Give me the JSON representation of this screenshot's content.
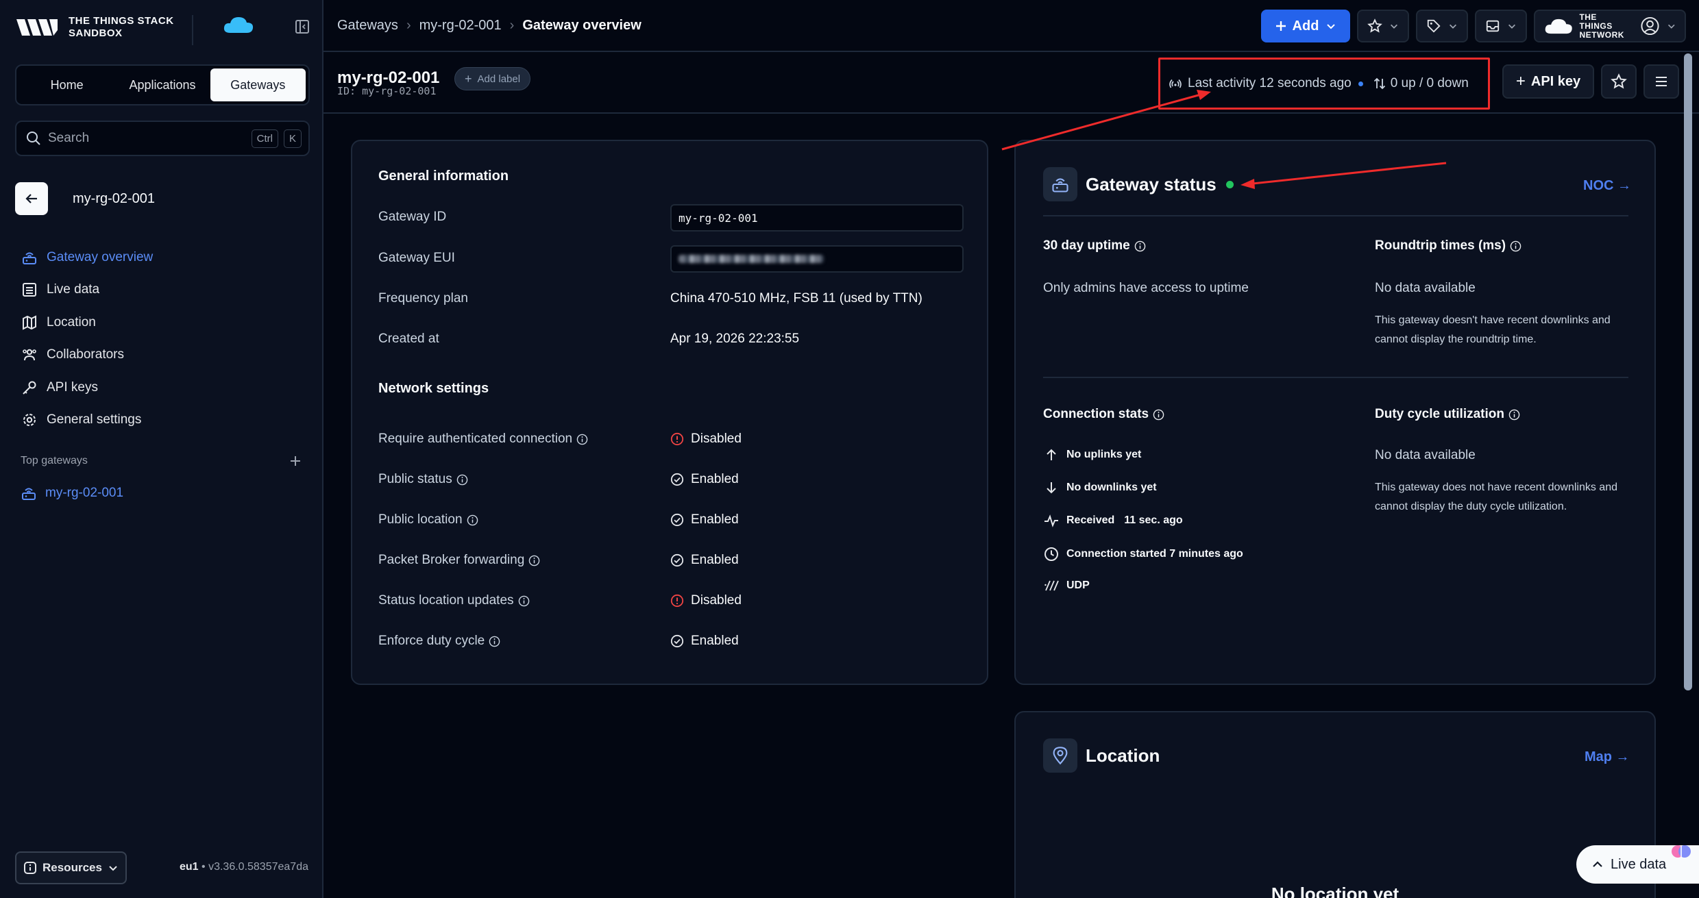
{
  "brand": {
    "line1": "The Things Stack",
    "line2": "Sandbox"
  },
  "nav_tabs": [
    {
      "label": "Home",
      "active": false
    },
    {
      "label": "Applications",
      "active": false
    },
    {
      "label": "Gateways",
      "active": true
    }
  ],
  "search": {
    "placeholder": "Search",
    "kbd1": "Ctrl",
    "kbd2": "K"
  },
  "sidebar": {
    "entity_title": "my-rg-02-001",
    "menu": [
      {
        "label": "Gateway overview",
        "icon": "gateway-icon",
        "active": true
      },
      {
        "label": "Live data",
        "icon": "list-icon",
        "active": false
      },
      {
        "label": "Location",
        "icon": "map-icon",
        "active": false
      },
      {
        "label": "Collaborators",
        "icon": "people-icon",
        "active": false
      },
      {
        "label": "API keys",
        "icon": "key-icon",
        "active": false
      },
      {
        "label": "General settings",
        "icon": "gear-icon",
        "active": false
      }
    ],
    "top_gateways_label": "Top gateways",
    "top_gateway_item": "my-rg-02-001",
    "resources_label": "Resources",
    "version_region": "eu1",
    "version_sep": " • ",
    "version_number": "v3.36.0.58357ea7da"
  },
  "header": {
    "breadcrumbs": [
      "Gateways",
      "my-rg-02-001",
      "Gateway overview"
    ],
    "add_label": "Add",
    "ttn_line1": "The Things",
    "ttn_line2": "Network"
  },
  "subheader": {
    "title": "my-rg-02-001",
    "id_line": "ID: my-rg-02-001",
    "add_label": "Add label",
    "last_activity": "Last activity 12 seconds ago",
    "updown": "0 up / 0 down",
    "api_key_label": "API key"
  },
  "general": {
    "title": "General information",
    "rows": [
      {
        "label": "Gateway ID",
        "value": "my-rg-02-001"
      },
      {
        "label": "Gateway EUI",
        "value": ""
      },
      {
        "label": "Frequency plan",
        "value": "China 470-510 MHz, FSB 11 (used by TTN)"
      },
      {
        "label": "Created at",
        "value": "Apr 19, 2026 22:23:55"
      }
    ],
    "network_title": "Network settings",
    "settings": [
      {
        "label": "Require authenticated connection",
        "value": "Disabled",
        "status": "disabled"
      },
      {
        "label": "Public status",
        "value": "Enabled",
        "status": "enabled"
      },
      {
        "label": "Public location",
        "value": "Enabled",
        "status": "enabled"
      },
      {
        "label": "Packet Broker forwarding",
        "value": "Enabled",
        "status": "enabled"
      },
      {
        "label": "Status location updates",
        "value": "Disabled",
        "status": "disabled"
      },
      {
        "label": "Enforce duty cycle",
        "value": "Enabled",
        "status": "enabled"
      }
    ]
  },
  "status": {
    "title": "Gateway status",
    "noc_link": "NOC →",
    "uptime_title": "30 day uptime",
    "uptime_text": "Only admins have access to uptime",
    "roundtrip_title": "Roundtrip times (ms)",
    "roundtrip_value": "No data available",
    "roundtrip_note": "This gateway doesn't have recent downlinks and cannot display the roundtrip time.",
    "conn_title": "Connection stats",
    "conn_uplinks": "No uplinks yet",
    "conn_downlinks": "No downlinks yet",
    "conn_received_label": "Received",
    "conn_received_value": "11 sec. ago",
    "conn_started": "Connection started 7 minutes ago",
    "conn_protocol": "UDP",
    "duty_title": "Duty cycle utilization",
    "duty_value": "No data available",
    "duty_note": "This gateway does not have recent downlinks and cannot display the duty cycle utilization."
  },
  "location": {
    "title": "Location",
    "map_link": "Map →",
    "empty": "No location yet"
  },
  "live_data_label": "Live data",
  "colors": {
    "accent": "#2563eb",
    "link": "#4f7ff0",
    "online": "#22c55e",
    "annotation": "#ef2b2b",
    "disabled": "#ef4444"
  }
}
